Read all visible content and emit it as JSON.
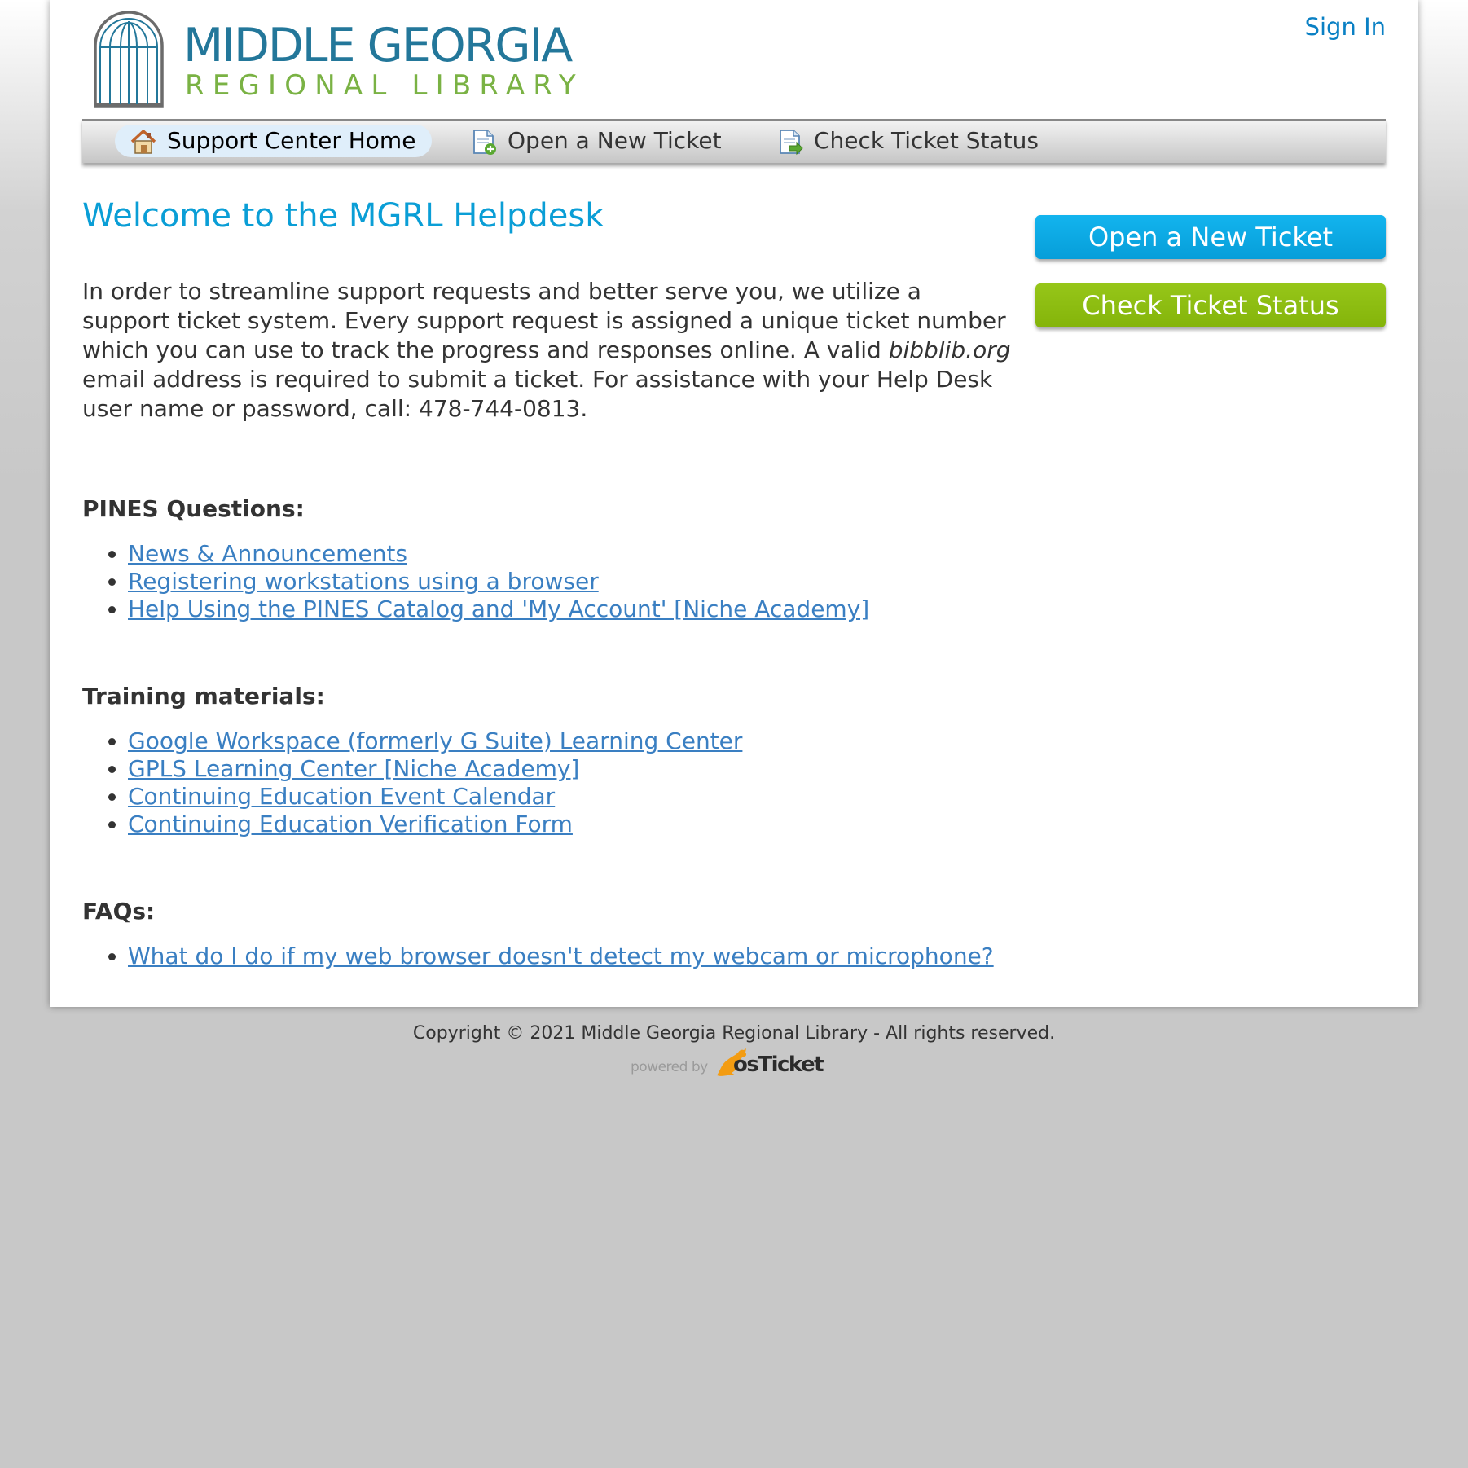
{
  "header": {
    "logo_line1": "MIDDLE GEORGIA",
    "logo_line2": "REGIONAL LIBRARY",
    "sign_in": "Sign In"
  },
  "nav": {
    "items": [
      {
        "label": "Support Center Home",
        "icon": "home-icon",
        "active": true
      },
      {
        "label": "Open a New Ticket",
        "icon": "new-ticket-icon",
        "active": false
      },
      {
        "label": "Check Ticket Status",
        "icon": "ticket-status-icon",
        "active": false
      }
    ]
  },
  "main": {
    "title": "Welcome to the MGRL Helpdesk",
    "intro_part1": "In order to streamline support requests and better serve you, we utilize a support ticket system. Every support request is assigned a unique ticket number which you can use to track the progress and responses online. A valid ",
    "intro_domain": "bibblib.org",
    "intro_part2": " email address is required to submit a ticket. For assistance with your Help Desk user name or password, call: 478-744-0813.",
    "sections": [
      {
        "title": "PINES Questions:",
        "links": [
          "News & Announcements",
          "Registering workstations using a browser",
          "Help Using the PINES Catalog and 'My Account' [Niche Academy]"
        ]
      },
      {
        "title": "Training materials:",
        "links": [
          "Google Workspace (formerly G Suite) Learning Center",
          "GPLS Learning Center [Niche Academy]",
          "Continuing Education Event Calendar",
          "Continuing Education Verification Form"
        ]
      },
      {
        "title": "FAQs:",
        "links": [
          "What do I do if my web browser doesn't detect my webcam or microphone?"
        ]
      }
    ]
  },
  "sidebar": {
    "open_ticket": "Open a New Ticket",
    "check_status": "Check Ticket Status"
  },
  "footer": {
    "copyright": "Copyright © 2021 Middle Georgia Regional Library - All rights reserved.",
    "powered_by": "powered by",
    "brand": "osTicket"
  },
  "colors": {
    "title_blue": "#0a9ed6",
    "link_blue": "#3a7fc2",
    "open_button": "#0ba8e6",
    "status_button": "#8dbe12",
    "logo_blue": "#23779a",
    "logo_green": "#7ab244"
  }
}
